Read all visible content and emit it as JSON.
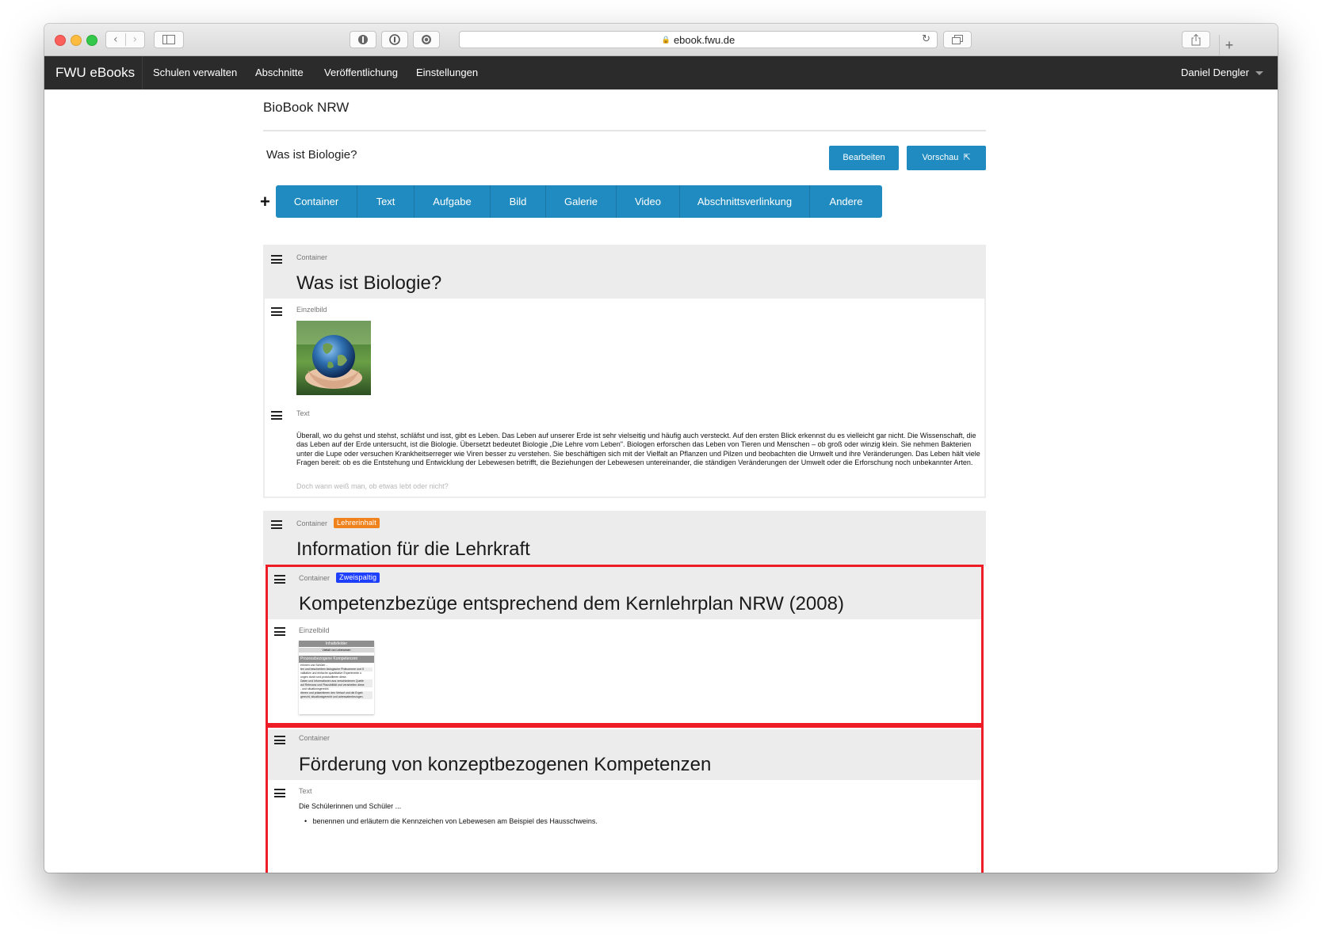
{
  "browser": {
    "url": "ebook.fwu.de",
    "icons": {
      "back": "chevron-left-icon",
      "forward": "chevron-right-icon",
      "sidebar": "sidebar-icon",
      "reload": "reload-icon",
      "share": "share-icon",
      "tabs": "tabs-icon",
      "new_tab": "plus-icon",
      "lock": "lock-icon"
    }
  },
  "navbar": {
    "brand": "FWU eBooks",
    "items": [
      "Schulen verwalten",
      "Abschnitte",
      "Veröffentlichung",
      "Einstellungen"
    ],
    "user": "Daniel Dengler"
  },
  "page": {
    "book_title": "BioBook NRW",
    "section_title": "Was ist Biologie?",
    "edit_label": "Bearbeiten",
    "preview_label": "Vorschau"
  },
  "insert_toolbar": {
    "items": [
      "Container",
      "Text",
      "Aufgabe",
      "Bild",
      "Galerie",
      "Video",
      "Abschnittsverlinkung",
      "Andere"
    ]
  },
  "blocks": {
    "container1": {
      "type": "Container",
      "heading": "Was ist Biologie?"
    },
    "image1": {
      "type": "Einzelbild"
    },
    "text1": {
      "type": "Text",
      "paragraph": "Überall, wo du gehst und stehst, schläfst und isst, gibt es Leben. Das Leben auf unserer Erde ist sehr vielseitig und häufig auch versteckt. Auf den ersten Blick erkennst du es vielleicht gar nicht. Die Wissenschaft, die das Leben auf der Erde untersucht, ist die Biologie. Übersetzt bedeutet Biologie „Die Lehre vom Leben\". Biologen erforschen das Leben von Tieren und Menschen – ob groß oder winzig klein. Sie nehmen Bakterien unter die Lupe oder versuchen Krankheitserreger wie Viren besser zu verstehen. Sie beschäftigen sich mit der Vielfalt an Pflanzen und Pilzen und beobachten die Umwelt und ihre Veränderungen. Das Leben hält viele Fragen bereit: ob es die Entstehung und Entwicklung der Lebewesen betrifft, die Beziehungen der Lebewesen untereinander, die ständigen Veränderungen der Umwelt oder die Erforschung noch unbekannter Arten.",
      "faded": "Doch wann weiß man, ob etwas lebt oder nicht?"
    },
    "container2": {
      "type": "Container",
      "badge": "Lehrerinhalt",
      "badge_color": "#f0821e",
      "heading": "Information für die Lehrkraft"
    },
    "container3": {
      "type": "Container",
      "badge": "Zweispaltig",
      "badge_color": "#1f3fff",
      "heading": "Kompetenzbezüge entsprechend dem Kernlehrplan NRW (2008)"
    },
    "image2": {
      "type": "Einzelbild",
      "thumb_header": "Inhaltsfelder",
      "thumb_sub": "Vielfalt von Lebewesen",
      "thumb_band": "Prozessbezogene Kompetenzen",
      "thumb_rows": [
        "erinnen und Schüler ...",
        "ten und beschreiben biologische Phänomene und S",
        "valitative und einfache quantitative Experimente u",
        "ungen durch und protokollieren diese.",
        "Daten und Informationen aus verschiedenen Quelle",
        "auf Relevanz und Plausibilität und verarbeiten diese",
        "- und situationsgerecht.",
        "rtieren und präsentieren den Verlauf und die Ergeb",
        "gerecht, situationsgerecht und adressatenbezogen."
      ]
    },
    "container4": {
      "type": "Container",
      "heading": "Förderung von konzeptbezogenen Kompetenzen"
    },
    "text2": {
      "type": "Text",
      "intro": "Die Schülerinnen und Schüler ...",
      "bullet": "benennen und erläutern die Kennzeichen von Lebewesen am Beispiel des Hausschweins."
    }
  },
  "highlight_color": "#ee1c25"
}
